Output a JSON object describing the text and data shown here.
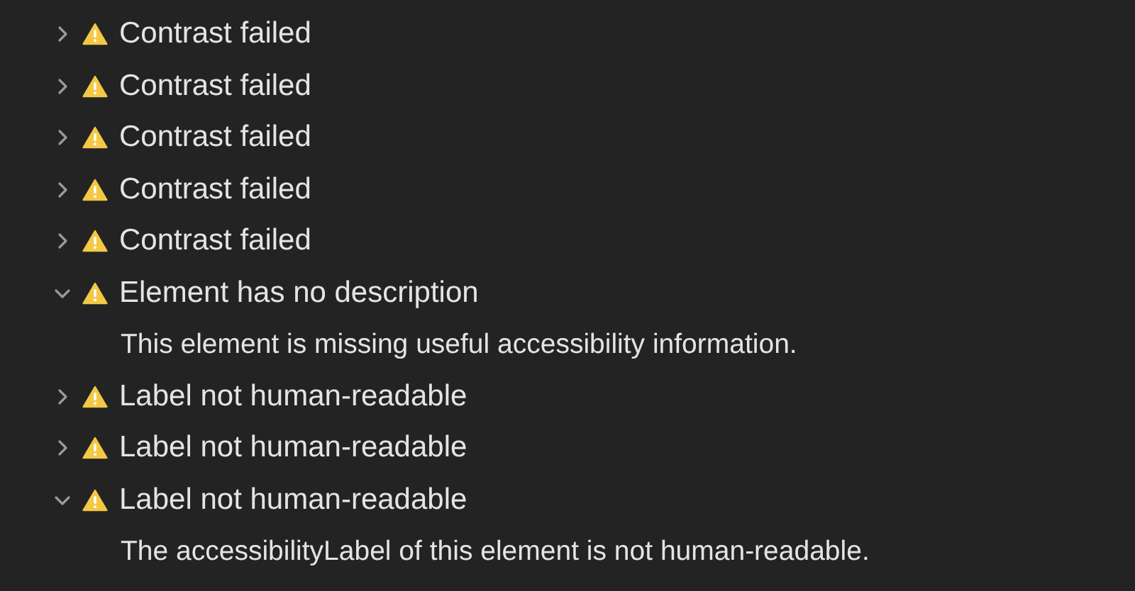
{
  "issues": [
    {
      "title": "Contrast failed",
      "expanded": false
    },
    {
      "title": "Contrast failed",
      "expanded": false
    },
    {
      "title": "Contrast failed",
      "expanded": false
    },
    {
      "title": "Contrast failed",
      "expanded": false
    },
    {
      "title": "Contrast failed",
      "expanded": false
    },
    {
      "title": "Element has no description",
      "expanded": true,
      "detail": "This element is missing useful accessibility information."
    },
    {
      "title": "Label not human-readable",
      "expanded": false
    },
    {
      "title": "Label not human-readable",
      "expanded": false
    },
    {
      "title": "Label not human-readable",
      "expanded": true,
      "detail": "The accessibilityLabel of this element is not human-readable."
    }
  ]
}
